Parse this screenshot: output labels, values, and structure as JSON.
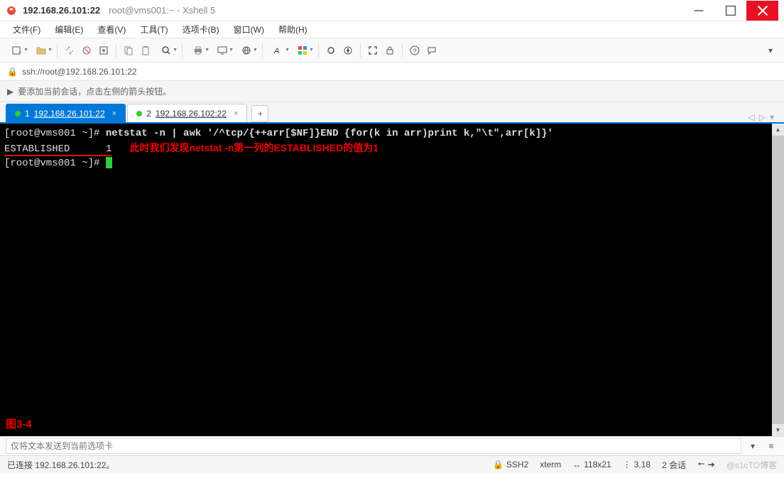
{
  "titlebar": {
    "main": "192.168.26.101:22",
    "sub": "root@vms001:~ - Xshell 5"
  },
  "menubar": {
    "items": [
      {
        "label": "文件(F)"
      },
      {
        "label": "编辑(E)"
      },
      {
        "label": "查看(V)"
      },
      {
        "label": "工具(T)"
      },
      {
        "label": "选项卡(B)"
      },
      {
        "label": "窗口(W)"
      },
      {
        "label": "帮助(H)"
      }
    ]
  },
  "address": {
    "url": "ssh://root@192.168.26.101:22"
  },
  "hint": {
    "text": "要添加当前会话，点击左侧的箭头按钮。"
  },
  "tabs": {
    "items": [
      {
        "num": "1",
        "label": "192.168.26.101:22",
        "active": true
      },
      {
        "num": "2",
        "label": "192.168.26.102:22",
        "active": false
      }
    ],
    "add": "+"
  },
  "terminal": {
    "prompt1": "[root@vms001 ~]# ",
    "cmd1": "netstat -n | awk '/^tcp/{++arr[$NF]}END {for(k in arr)print k,\"\\t\",arr[k]}'",
    "line2_left": "ESTABLISHED      1",
    "annotation": "此时我们发现netstat -n第一列的ESTABLISHED的值为1",
    "prompt3": "[root@vms001 ~]# ",
    "figure": "图3-4"
  },
  "inputbar": {
    "placeholder": "仅将文本发送到当前选项卡"
  },
  "statusbar": {
    "connected": "已连接 192.168.26.101:22。",
    "proto": "SSH2",
    "term": "xterm",
    "size": "118x21",
    "pos": "3,18",
    "sessions": "2 会话",
    "watermark": "@s1cTO博客"
  }
}
